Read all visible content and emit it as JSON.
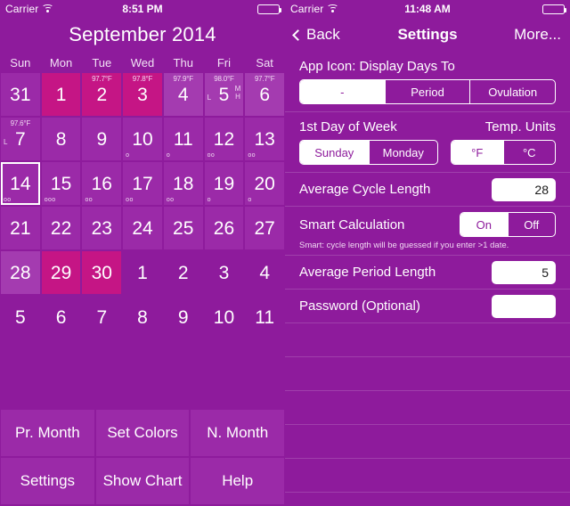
{
  "calendar_screen": {
    "status_bar": {
      "carrier": "Carrier",
      "wifi_icon": "wifi-icon",
      "time": "8:51 PM",
      "battery_icon": "battery-icon"
    },
    "title": "September 2014",
    "day_headers": [
      "Sun",
      "Mon",
      "Tue",
      "Wed",
      "Thu",
      "Fri",
      "Sat"
    ],
    "weeks": [
      [
        {
          "day": "31",
          "style": "normal"
        },
        {
          "day": "1",
          "style": "period"
        },
        {
          "day": "2",
          "style": "period",
          "temp": "97.7°F"
        },
        {
          "day": "3",
          "style": "period",
          "temp": "97.8°F"
        },
        {
          "day": "4",
          "style": "light",
          "temp": "97.9°F"
        },
        {
          "day": "5",
          "style": "light",
          "temp": "98.0°F",
          "flow_low": "L",
          "flow_mh": [
            "M",
            "H"
          ]
        },
        {
          "day": "6",
          "style": "light",
          "temp": "97.7°F"
        }
      ],
      [
        {
          "day": "7",
          "style": "normal",
          "temp": "97.6°F",
          "flow_low": "L"
        },
        {
          "day": "8",
          "style": "normal"
        },
        {
          "day": "9",
          "style": "normal"
        },
        {
          "day": "10",
          "style": "normal",
          "ovulation": "o"
        },
        {
          "day": "11",
          "style": "normal",
          "ovulation": "o"
        },
        {
          "day": "12",
          "style": "normal",
          "ovulation": "oo"
        },
        {
          "day": "13",
          "style": "normal",
          "ovulation": "oo"
        }
      ],
      [
        {
          "day": "14",
          "style": "normal",
          "ovulation": "oo",
          "selected": true
        },
        {
          "day": "15",
          "style": "normal",
          "ovulation": "ooo"
        },
        {
          "day": "16",
          "style": "normal",
          "ovulation": "oo"
        },
        {
          "day": "17",
          "style": "normal",
          "ovulation": "oo"
        },
        {
          "day": "18",
          "style": "normal",
          "ovulation": "oo"
        },
        {
          "day": "19",
          "style": "normal",
          "ovulation": "o"
        },
        {
          "day": "20",
          "style": "normal",
          "ovulation": "o"
        }
      ],
      [
        {
          "day": "21",
          "style": "normal"
        },
        {
          "day": "22",
          "style": "normal"
        },
        {
          "day": "23",
          "style": "normal"
        },
        {
          "day": "24",
          "style": "normal"
        },
        {
          "day": "25",
          "style": "normal"
        },
        {
          "day": "26",
          "style": "normal"
        },
        {
          "day": "27",
          "style": "normal"
        }
      ],
      [
        {
          "day": "28",
          "style": "light"
        },
        {
          "day": "29",
          "style": "period"
        },
        {
          "day": "30",
          "style": "period"
        },
        {
          "day": "1",
          "style": "none"
        },
        {
          "day": "2",
          "style": "none"
        },
        {
          "day": "3",
          "style": "none"
        },
        {
          "day": "4",
          "style": "none"
        }
      ],
      [
        {
          "day": "5",
          "style": "none"
        },
        {
          "day": "6",
          "style": "none"
        },
        {
          "day": "7",
          "style": "none"
        },
        {
          "day": "8",
          "style": "none"
        },
        {
          "day": "9",
          "style": "none"
        },
        {
          "day": "10",
          "style": "none"
        },
        {
          "day": "11",
          "style": "none"
        }
      ]
    ],
    "buttons": [
      [
        "Pr. Month",
        "Set Colors",
        "N. Month"
      ],
      [
        "Settings",
        "Show Chart",
        "Help"
      ]
    ]
  },
  "settings_screen": {
    "status_bar": {
      "carrier": "Carrier",
      "wifi_icon": "wifi-icon",
      "time": "11:48 AM",
      "battery_icon": "battery-icon"
    },
    "nav": {
      "back_label": "Back",
      "back_icon": "chevron-left-icon",
      "title": "Settings",
      "more_label": "More..."
    },
    "app_icon_row": {
      "label": "App Icon: Display Days To",
      "options": [
        "-",
        "Period",
        "Ovulation"
      ],
      "selected": "-"
    },
    "first_day_row": {
      "label": "1st Day of Week",
      "options": [
        "Sunday",
        "Monday"
      ],
      "selected": "Sunday"
    },
    "temp_units": {
      "label": "Temp. Units",
      "options": [
        "°F",
        "°C"
      ],
      "selected": "°F"
    },
    "avg_cycle": {
      "label": "Average Cycle Length",
      "value": "28",
      "placeholder": ""
    },
    "smart_calc": {
      "label": "Smart Calculation",
      "options": [
        "On",
        "Off"
      ],
      "selected": "On",
      "hint": "Smart: cycle length will be guessed if you enter >1 date."
    },
    "avg_period": {
      "label": "Average Period Length",
      "value": "5",
      "placeholder": ""
    },
    "password": {
      "label": "Password (Optional)",
      "value": "",
      "placeholder": ""
    }
  },
  "colors": {
    "background": "#8e1b9c",
    "cell_normal": "#9b2aa8",
    "cell_period": "#c51585",
    "cell_light": "#a43bb0",
    "text": "#ffffff"
  }
}
